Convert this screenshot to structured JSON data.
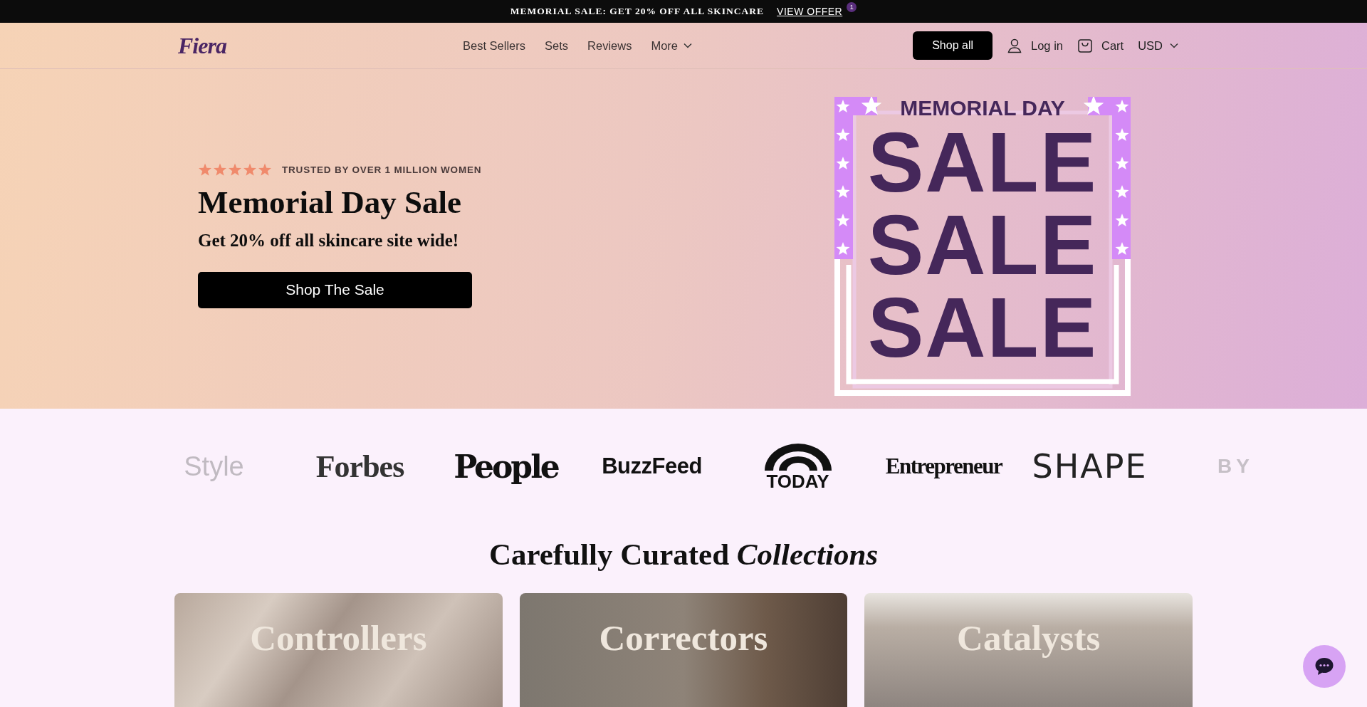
{
  "announcement": {
    "text": "MEMORIAL SALE: GET 20% OFF ALL SKINCARE",
    "link": "VIEW OFFER",
    "badge": "1"
  },
  "header": {
    "logo": "Fiera",
    "nav": [
      {
        "label": "Best Sellers",
        "kind": "link"
      },
      {
        "label": "Sets",
        "kind": "link"
      },
      {
        "label": "Reviews",
        "kind": "link"
      },
      {
        "label": "More",
        "kind": "dropdown"
      }
    ],
    "shop_all": "Shop all",
    "login": "Log in",
    "cart": "Cart",
    "currency": "USD"
  },
  "hero": {
    "stars": 5,
    "trust": "TRUSTED BY OVER 1 MILLION WOMEN",
    "title": "Memorial Day Sale",
    "subtitle": "Get 20% off all skincare site wide!",
    "button": "Shop The Sale",
    "graphic": {
      "heading": "MEMORIAL DAY",
      "words": [
        "SALE",
        "SALE",
        "SALE"
      ]
    }
  },
  "press": [
    {
      "name": "Style",
      "kind": "sans-light"
    },
    {
      "name": "Forbes",
      "kind": "serif"
    },
    {
      "name": "People",
      "kind": "heavy"
    },
    {
      "name": "BuzzFeed",
      "kind": "sans-bold"
    },
    {
      "name": "TODAY",
      "kind": "arc"
    },
    {
      "name": "Entrepreneur",
      "kind": "condensed"
    },
    {
      "name": "SHAPE",
      "kind": "sans-wide"
    },
    {
      "name": "BY",
      "kind": "sans-spaced"
    }
  ],
  "collections": {
    "heading": "Carefully Curated *Collections*",
    "cards": [
      {
        "title": "Controllers"
      },
      {
        "title": "Correctors"
      },
      {
        "title": "Catalysts"
      }
    ]
  }
}
